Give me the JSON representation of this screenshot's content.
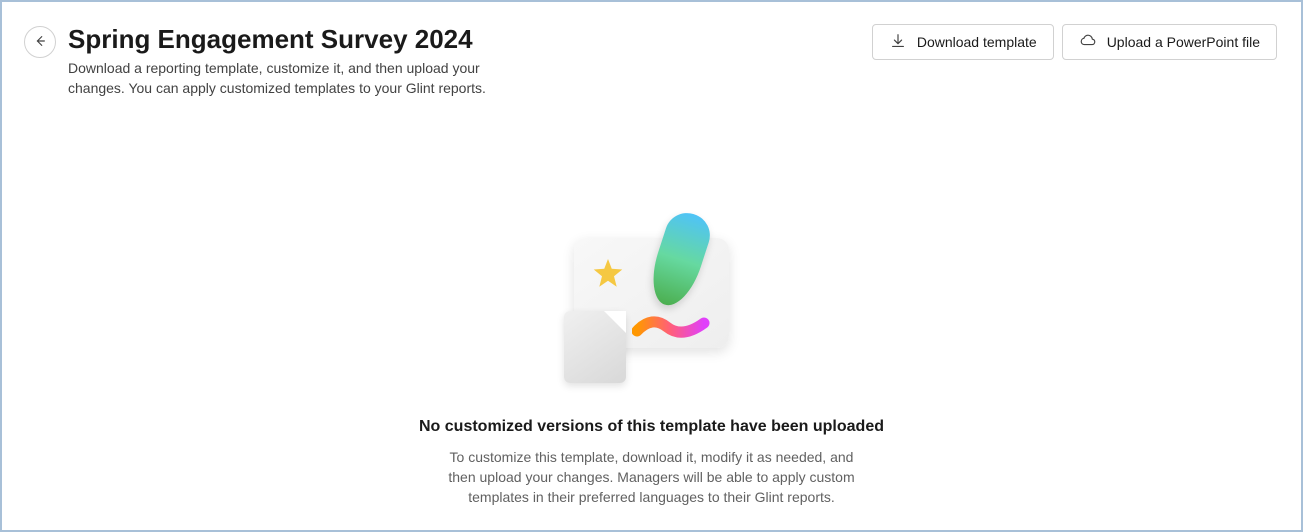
{
  "header": {
    "title": "Spring Engagement Survey 2024",
    "subtitle": "Download a reporting template, customize it, and then upload your changes. You can apply customized templates to your Glint reports."
  },
  "actions": {
    "download_label": "Download template",
    "upload_label": "Upload a PowerPoint file"
  },
  "empty_state": {
    "title": "No customized versions of this template have been uploaded",
    "description": "To customize this template, download it, modify it as needed, and then upload your changes. Managers will be able to apply custom templates in their preferred languages to their Glint reports."
  }
}
